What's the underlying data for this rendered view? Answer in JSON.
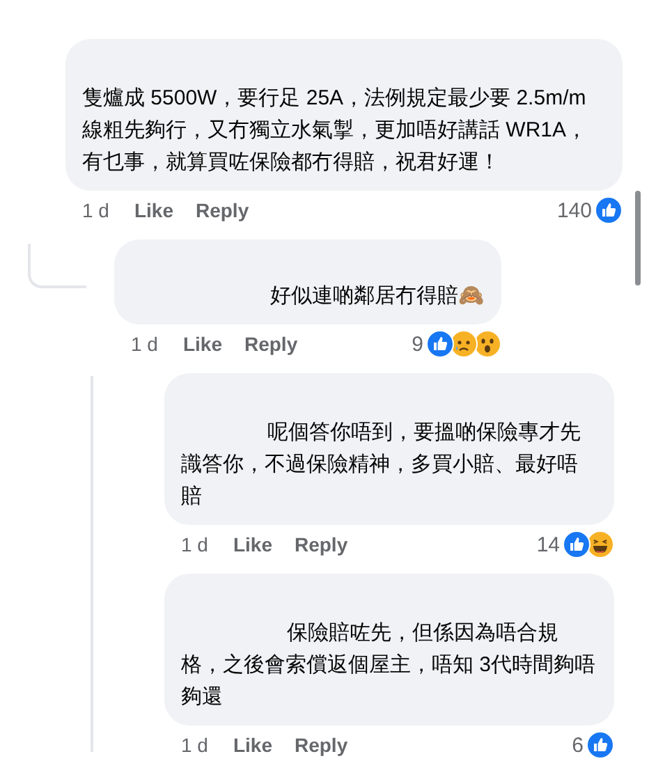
{
  "comments": [
    {
      "text": "隻爐成 5500W，要行足 25A，法例規定最少要 2.5m/m 線粗先夠行，又冇獨立水氣掣，更加唔好講話 WR1A，有乜事，就算買咗保險都冇得賠，祝君好運！",
      "time": "1 d",
      "like": "Like",
      "reply": "Reply",
      "count": "140",
      "reactions": [
        {
          "kind": "like"
        }
      ],
      "children": [
        {
          "text": "好似連啲鄰居冇得賠🙈",
          "time": "1 d",
          "like": "Like",
          "reply": "Reply",
          "count": "9",
          "reactions": [
            {
              "kind": "like"
            },
            {
              "kind": "sad"
            },
            {
              "kind": "wow"
            }
          ],
          "children": [
            {
              "text": "呢個答你唔到，要搵啲保險專才先識答你，不過保險精神，多買小賠、最好唔賠",
              "time": "1 d",
              "like": "Like",
              "reply": "Reply",
              "count": "14",
              "reactions": [
                {
                  "kind": "like"
                },
                {
                  "kind": "haha"
                }
              ]
            },
            {
              "text": "保險賠咗先，但係因為唔合規格，之後會索償返個屋主，唔知 3代時間夠唔夠還",
              "time": "1 d",
              "like": "Like",
              "reply": "Reply",
              "count": "6",
              "reactions": [
                {
                  "kind": "like"
                }
              ]
            }
          ]
        }
      ]
    }
  ]
}
